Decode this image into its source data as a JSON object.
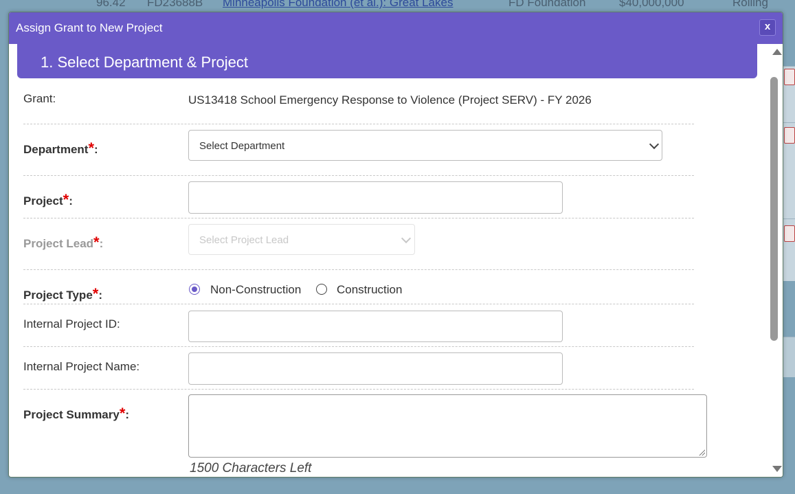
{
  "background": {
    "row": [
      "96.42",
      "FD23688B",
      "Minneapolis Foundation (et al.): Great Lakes",
      "FD Foundation",
      "$40,000,000",
      "Rolling"
    ]
  },
  "modal": {
    "title": "Assign Grant to New Project",
    "close_label": "x",
    "section_title": "1. Select Department & Project"
  },
  "form": {
    "grant_label": "Grant:",
    "grant_value": "US13418 School Emergency Response to Violence (Project SERV) - FY 2026",
    "department_label": "Department",
    "department_value": "Select Department",
    "project_label": "Project",
    "project_value": "",
    "project_lead_label": "Project Lead",
    "project_lead_value": "Select Project Lead",
    "project_type_label": "Project Type",
    "project_type_options": [
      "Non-Construction",
      "Construction"
    ],
    "project_type_selected": "Non-Construction",
    "internal_id_label": "Internal Project ID:",
    "internal_id_value": "",
    "internal_name_label": "Internal Project Name:",
    "internal_name_value": "",
    "summary_label": "Project Summary",
    "summary_value": "",
    "chars_left": "1500 Characters Left",
    "required_mark": "*",
    "colon": ":"
  },
  "colors": {
    "accent": "#6a5ac8",
    "required": "#e00000",
    "backdrop": "#7ea3b8"
  }
}
